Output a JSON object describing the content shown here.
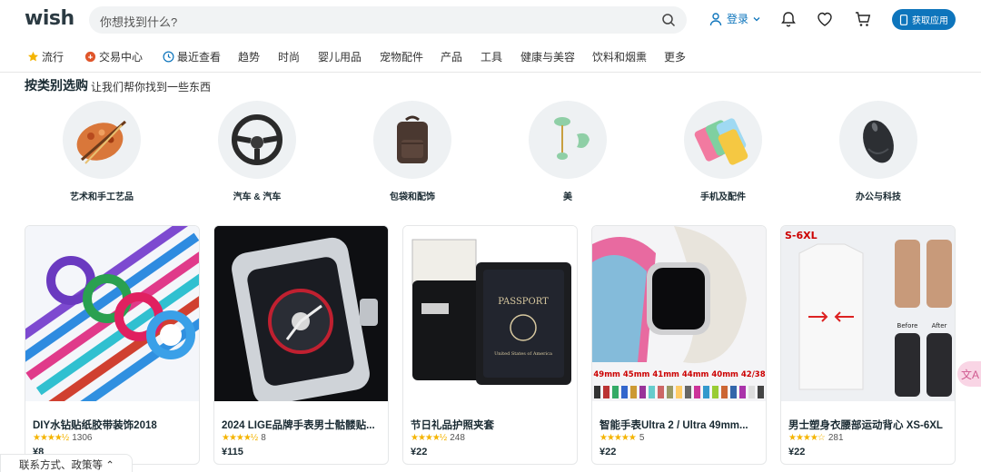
{
  "header": {
    "logo": "wish",
    "search_placeholder": "你想找到什么?",
    "login": "登录",
    "get_app": "获取应用"
  },
  "nav": [
    {
      "label": "流行",
      "icon": "star-icon"
    },
    {
      "label": "交易中心",
      "icon": "deal-icon"
    },
    {
      "label": "最近查看",
      "icon": "clock-icon"
    },
    {
      "label": "趋势"
    },
    {
      "label": "时尚"
    },
    {
      "label": "婴儿用品"
    },
    {
      "label": "宠物配件"
    },
    {
      "label": "产品"
    },
    {
      "label": "工具"
    },
    {
      "label": "健康与美容"
    },
    {
      "label": "饮料和烟熏"
    },
    {
      "label": "更多"
    }
  ],
  "categories_section": {
    "title": "按类别选购",
    "subtitle": "让我们帮你找到一些东西",
    "items": [
      {
        "label": "艺术和手工艺品",
        "icon": "palette-icon"
      },
      {
        "label": "汽车 & 汽车",
        "icon": "steering-wheel-icon"
      },
      {
        "label": "包袋和配饰",
        "icon": "backpack-icon"
      },
      {
        "label": "美",
        "icon": "face-roller-icon"
      },
      {
        "label": "手机及配件",
        "icon": "phone-cases-icon"
      },
      {
        "label": "办公与科技",
        "icon": "mouse-icon"
      }
    ]
  },
  "products": [
    {
      "title": "DIY水钻贴纸胶带装饰2018",
      "rating": 4.5,
      "reviews": "1306",
      "price": "¥8"
    },
    {
      "title": "2024 LIGE品牌手表男士骷髅贴...",
      "rating": 4.5,
      "reviews": "8",
      "price": "¥115"
    },
    {
      "title": "节日礼品护照夹套",
      "rating": 4.5,
      "reviews": "248",
      "price": "¥22"
    },
    {
      "title": "智能手表Ultra 2 / Ultra 49mm...",
      "rating": 5,
      "reviews": "5",
      "price": "¥22"
    },
    {
      "title": "男士塑身衣腰部运动背心 XS-6XL",
      "rating": 4,
      "reviews": "281",
      "price": "¥22"
    }
  ],
  "product_image_text": {
    "passport": "PASSPORT",
    "passport_sub": "United States of America",
    "strap_sizes": "49mm 45mm 41mm 44mm 40mm 42/38",
    "shirt_sizes": "S-6XL",
    "before": "Before",
    "after": "After"
  },
  "footer": {
    "contact": "联系方式、政策等"
  },
  "colors": {
    "accent": "#0e75bc",
    "star": "#f4b400"
  }
}
